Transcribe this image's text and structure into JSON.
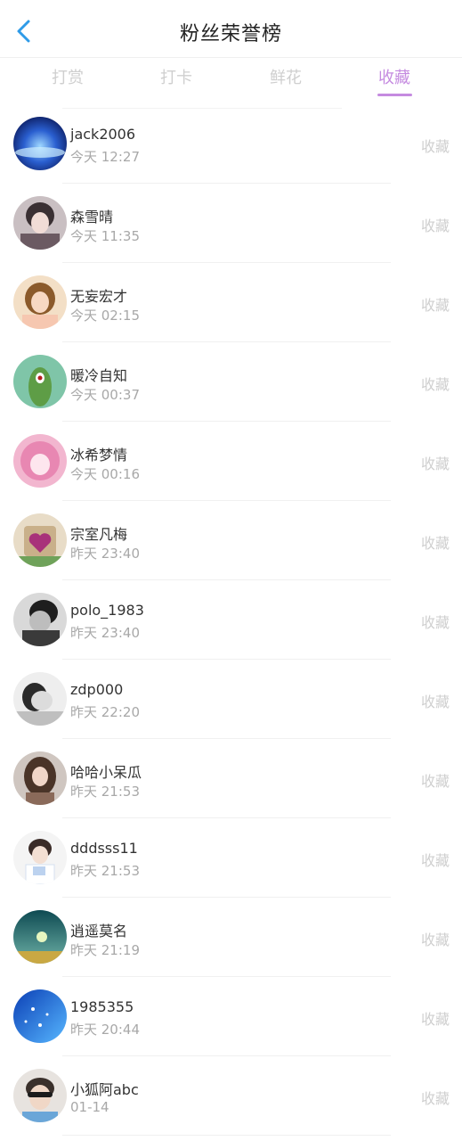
{
  "header": {
    "title": "粉丝荣誉榜",
    "back_icon": "chevron-left-icon",
    "back_color": "#2f9be8"
  },
  "tabs": [
    {
      "label": "打赏",
      "active": false
    },
    {
      "label": "打卡",
      "active": false
    },
    {
      "label": "鲜花",
      "active": false
    },
    {
      "label": "收藏",
      "active": true
    }
  ],
  "accent": "#c58be0",
  "list": [
    {
      "name": "jack2006",
      "time": "今天 12:27",
      "action": "收藏"
    },
    {
      "name": "森雪晴",
      "time": "今天 11:35",
      "action": "收藏"
    },
    {
      "name": "无妄宏才",
      "time": "今天 02:15",
      "action": "收藏"
    },
    {
      "name": "暖冷自知",
      "time": "今天 00:37",
      "action": "收藏"
    },
    {
      "name": "冰希梦情",
      "time": "今天 00:16",
      "action": "收藏"
    },
    {
      "name": "宗室凡梅",
      "time": "昨天 23:40",
      "action": "收藏"
    },
    {
      "name": "polo_1983",
      "time": "昨天 23:40",
      "action": "收藏"
    },
    {
      "name": "zdp000",
      "time": "昨天 22:20",
      "action": "收藏"
    },
    {
      "name": "哈哈小呆瓜",
      "time": "昨天 21:53",
      "action": "收藏"
    },
    {
      "name": "dddsss11",
      "time": "昨天 21:53",
      "action": "收藏"
    },
    {
      "name": "逍遥莫名",
      "time": "昨天 21:19",
      "action": "收藏"
    },
    {
      "name": "1985355",
      "time": "昨天 20:44",
      "action": "收藏"
    },
    {
      "name": "小狐阿abc",
      "time": "01-14",
      "action": "收藏"
    }
  ]
}
